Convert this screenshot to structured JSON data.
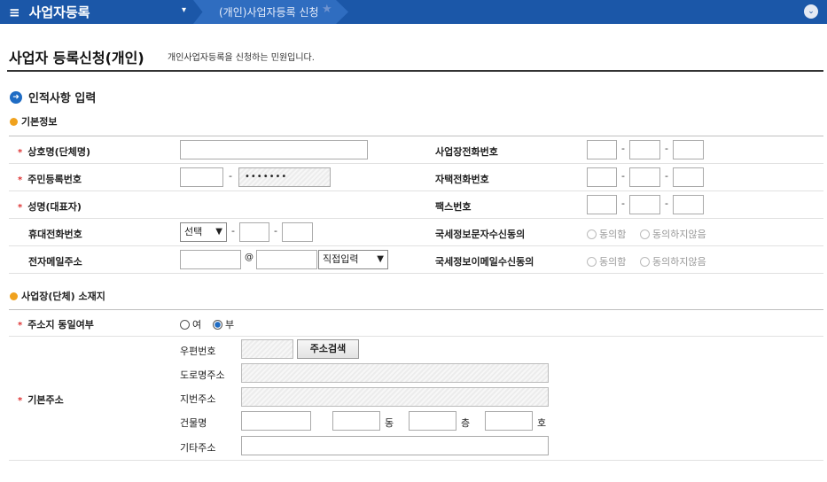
{
  "nav": {
    "menu_icon": "≡",
    "menu_label": "사업자등록",
    "dropdown_icon": "▾",
    "breadcrumb": "(개인)사업자등록 신청",
    "star": "★",
    "scroll_icon": "⌄"
  },
  "page": {
    "title": "사업자 등록신청(개인)",
    "description": "개인사업자등록을 신청하는 민원입니다."
  },
  "section1": {
    "icon": "➜",
    "title": "인적사항 입력",
    "sub": "기본정보",
    "req_mark": "*",
    "fields": {
      "company_name": "상호명(단체명)",
      "resident_no": "주민등록번호",
      "resident_no_masked": "•••••••",
      "rep_name": "성명(대표자)",
      "mobile": "휴대전화번호",
      "mobile_select": "선택",
      "email": "전자메일주소",
      "email_at": "@",
      "email_domain": "직접입력",
      "biz_phone": "사업장전화번호",
      "home_phone": "자택전화번호",
      "fax": "팩스번호",
      "sms_consent": "국세정보문자수신동의",
      "email_consent": "국세정보이메일수신동의",
      "agree": "동의함",
      "disagree": "동의하지않음",
      "dash": "-"
    }
  },
  "section2": {
    "sub": "사업장(단체) 소재지",
    "same_addr": "주소지 동일여부",
    "yes": "여",
    "no": "부",
    "base_addr": "기본주소",
    "postal": "우편번호",
    "search_btn": "주소검색",
    "road_addr": "도로명주소",
    "lot_addr": "지번주소",
    "building": "건물명",
    "dong": "동",
    "floor": "층",
    "ho": "호",
    "other_addr": "기타주소"
  }
}
